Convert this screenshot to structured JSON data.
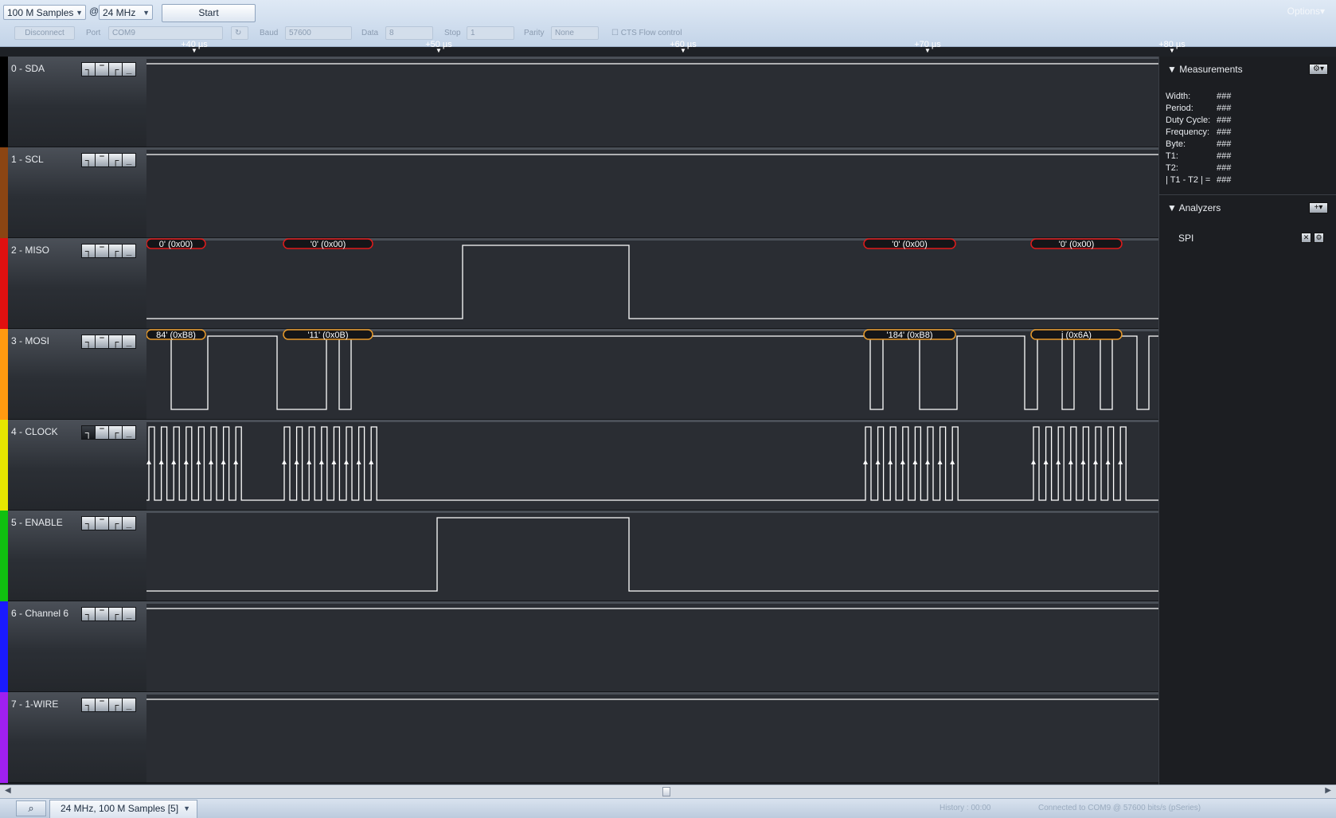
{
  "toolbar": {
    "samples_value": "100 M Samples",
    "at_sign": "@",
    "rate_value": "24 MHz",
    "start_label": "Start",
    "options_label": "Options▾",
    "disconnect_label": "Disconnect",
    "port_label": "Port",
    "port_value": "COM9",
    "baud_label": "Baud",
    "baud_value": "57600",
    "data_label": "Data",
    "data_value": "8",
    "stop_label": "Stop",
    "stop_value": "1",
    "parity_label": "Parity",
    "parity_value": "None",
    "cts_label": "CTS Flow control"
  },
  "ruler": {
    "ticks": [
      "+40 µs",
      "+50 µs",
      "+60 µs",
      "+70 µs",
      "+80 µs"
    ]
  },
  "channels": [
    {
      "name": "0 - SDA",
      "color": "#000000"
    },
    {
      "name": "1 - SCL",
      "color": "#8b4513"
    },
    {
      "name": "2 - MISO",
      "color": "#e01010"
    },
    {
      "name": "3 - MOSI",
      "color": "#ff9a10"
    },
    {
      "name": "4 - CLOCK",
      "color": "#e6e600"
    },
    {
      "name": "5 - ENABLE",
      "color": "#10c010"
    },
    {
      "name": "6 - Channel 6",
      "color": "#1a1aff"
    },
    {
      "name": "7 - 1-WIRE",
      "color": "#a020f0"
    }
  ],
  "decodes": {
    "miso": [
      "0' (0x00)",
      "'0' (0x00)",
      "'0' (0x00)",
      "'0' (0x00)"
    ],
    "mosi": [
      "84' (0xB8)",
      "'11' (0x0B)",
      "'184' (0xB8)",
      "j (0x6A)"
    ]
  },
  "measurements": {
    "title": "Measurements",
    "rows": [
      {
        "label": "Width:",
        "value": "###"
      },
      {
        "label": "Period:",
        "value": "###"
      },
      {
        "label": "Duty Cycle:",
        "value": "###"
      },
      {
        "label": "Frequency:",
        "value": "###"
      },
      {
        "label": "Byte:",
        "value": "###"
      },
      {
        "label": "T1:",
        "value": "###"
      },
      {
        "label": "T2:",
        "value": "###"
      },
      {
        "label": "| T1 - T2 | =",
        "value": "###"
      }
    ]
  },
  "analyzers": {
    "title": "Analyzers",
    "items": [
      "SPI"
    ]
  },
  "statusbar": {
    "session_tab": "24 MHz, 100 M Samples [5]",
    "history": "History : 00:00",
    "connection": "Connected to COM9 @ 57600 bits/s (pSeries)"
  },
  "colors": {
    "decode_miso": "#e01b1b",
    "decode_mosi": "#e89a2a",
    "trace": "#ffffff"
  }
}
